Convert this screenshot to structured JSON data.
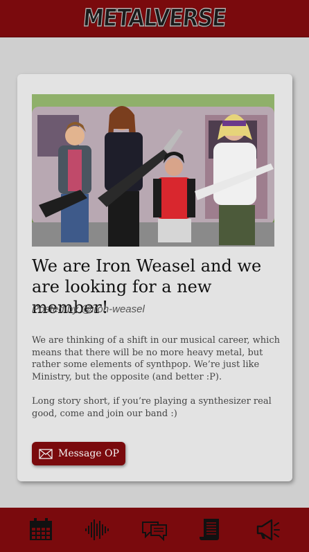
{
  "header": {
    "logo_text": "METALVERSE"
  },
  "post": {
    "title": "We are Iron Weasel and we are looking for a new member!",
    "byline": "Posted by @iron-weasel",
    "paragraphs": [
      "We are thinking of a shift in our musical career, which means that there will be no more heavy metal, but rather some elements of synthpop. We’re just like Ministry, but the opposite (and better :P).",
      "Long story short, if you’re playing a synthesizer real good, come and join our band :)"
    ],
    "message_button": "Message OP"
  },
  "nav": {
    "items": [
      {
        "name": "calendar-icon"
      },
      {
        "name": "soundwave-icon"
      },
      {
        "name": "chat-bubbles-icon"
      },
      {
        "name": "scroll-icon"
      },
      {
        "name": "megaphone-icon"
      }
    ]
  },
  "colors": {
    "brand": "#7a0a0d",
    "background": "#cfcfcf",
    "card": "#e3e3e3"
  }
}
